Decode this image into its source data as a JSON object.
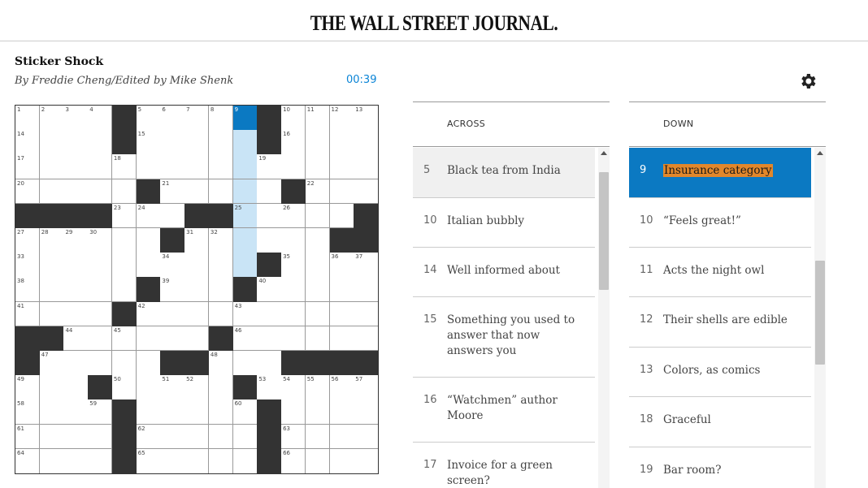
{
  "masthead": {
    "logo": "THE WALL STREET JOURNAL."
  },
  "puzzle": {
    "title": "Sticker Shock",
    "byline": "By Freddie Cheng/Edited by Mike Shenk",
    "timer": "00:39"
  },
  "icons": {
    "settings": "gear-icon",
    "scroll_up": "triangle-up-icon"
  },
  "colors": {
    "accent": "#0b79c2",
    "highlight": "#c9e4f6",
    "block": "#333333",
    "timer": "#0a84d6",
    "clue_highlight": "#e2872b"
  },
  "grid": {
    "size": 15,
    "rows": [
      "....#....1#....",
      "....#....0#....",
      "....#.........."
    ],
    "blocks": [
      [
        0,
        4
      ],
      [
        0,
        10
      ],
      [
        1,
        4
      ],
      [
        1,
        10
      ],
      [
        3,
        5
      ],
      [
        3,
        11
      ],
      [
        4,
        0
      ],
      [
        4,
        1
      ],
      [
        4,
        2
      ],
      [
        4,
        3
      ],
      [
        4,
        7
      ],
      [
        4,
        8
      ],
      [
        4,
        14
      ],
      [
        5,
        6
      ],
      [
        5,
        13
      ],
      [
        5,
        14
      ],
      [
        6,
        10
      ],
      [
        7,
        5
      ],
      [
        7,
        9
      ],
      [
        8,
        4
      ],
      [
        9,
        0
      ],
      [
        9,
        1
      ],
      [
        9,
        8
      ],
      [
        10,
        0
      ],
      [
        10,
        6
      ],
      [
        10,
        7
      ],
      [
        10,
        11
      ],
      [
        10,
        12
      ],
      [
        10,
        13
      ],
      [
        10,
        14
      ],
      [
        11,
        3
      ],
      [
        11,
        9
      ],
      [
        12,
        4
      ],
      [
        12,
        10
      ],
      [
        13,
        4
      ],
      [
        13,
        10
      ],
      [
        14,
        4
      ],
      [
        14,
        10
      ]
    ],
    "numbers": [
      [
        0,
        0,
        "1"
      ],
      [
        0,
        1,
        "2"
      ],
      [
        0,
        2,
        "3"
      ],
      [
        0,
        3,
        "4"
      ],
      [
        0,
        5,
        "5"
      ],
      [
        0,
        6,
        "6"
      ],
      [
        0,
        7,
        "7"
      ],
      [
        0,
        8,
        "8"
      ],
      [
        0,
        9,
        "9"
      ],
      [
        0,
        11,
        "10"
      ],
      [
        0,
        12,
        "11"
      ],
      [
        0,
        13,
        "12"
      ],
      [
        0,
        14,
        "13"
      ],
      [
        1,
        0,
        "14"
      ],
      [
        1,
        5,
        "15"
      ],
      [
        1,
        11,
        "16"
      ],
      [
        2,
        0,
        "17"
      ],
      [
        2,
        4,
        "18"
      ],
      [
        2,
        10,
        "19"
      ],
      [
        3,
        0,
        "20"
      ],
      [
        3,
        6,
        "21"
      ],
      [
        3,
        12,
        "22"
      ],
      [
        4,
        4,
        "23"
      ],
      [
        4,
        5,
        "24"
      ],
      [
        4,
        9,
        "25"
      ],
      [
        4,
        11,
        "26"
      ],
      [
        5,
        0,
        "27"
      ],
      [
        5,
        1,
        "28"
      ],
      [
        5,
        2,
        "29"
      ],
      [
        5,
        3,
        "30"
      ],
      [
        5,
        7,
        "31"
      ],
      [
        5,
        8,
        "32"
      ],
      [
        6,
        0,
        "33"
      ],
      [
        6,
        6,
        "34"
      ],
      [
        6,
        11,
        "35"
      ],
      [
        6,
        13,
        "36"
      ],
      [
        6,
        14,
        "37"
      ],
      [
        7,
        0,
        "38"
      ],
      [
        7,
        6,
        "39"
      ],
      [
        7,
        10,
        "40"
      ],
      [
        8,
        0,
        "41"
      ],
      [
        8,
        5,
        "42"
      ],
      [
        8,
        9,
        "43"
      ],
      [
        9,
        2,
        "44"
      ],
      [
        9,
        4,
        "45"
      ],
      [
        9,
        9,
        "46"
      ],
      [
        10,
        1,
        "47"
      ],
      [
        10,
        8,
        "48"
      ],
      [
        11,
        0,
        "49"
      ],
      [
        11,
        4,
        "50"
      ],
      [
        11,
        6,
        "51"
      ],
      [
        11,
        7,
        "52"
      ],
      [
        11,
        10,
        "53"
      ],
      [
        11,
        11,
        "54"
      ],
      [
        11,
        12,
        "55"
      ],
      [
        11,
        13,
        "56"
      ],
      [
        11,
        14,
        "57"
      ],
      [
        12,
        0,
        "58"
      ],
      [
        12,
        3,
        "59"
      ],
      [
        12,
        9,
        "60"
      ],
      [
        13,
        0,
        "61"
      ],
      [
        13,
        5,
        "62"
      ],
      [
        13,
        11,
        "63"
      ],
      [
        14,
        0,
        "64"
      ],
      [
        14,
        5,
        "65"
      ],
      [
        14,
        11,
        "66"
      ]
    ],
    "active": [
      0,
      9
    ],
    "highlighted": [
      [
        1,
        9
      ],
      [
        2,
        9
      ],
      [
        3,
        9
      ],
      [
        4,
        9
      ],
      [
        5,
        9
      ],
      [
        6,
        9
      ]
    ]
  },
  "across": {
    "heading": "ACROSS",
    "clues": [
      {
        "num": "5",
        "text": "Black tea from India"
      },
      {
        "num": "10",
        "text": "Italian bubbly"
      },
      {
        "num": "14",
        "text": "Well informed about"
      },
      {
        "num": "15",
        "text": "Something you used to answer that now answers you"
      },
      {
        "num": "16",
        "text": "“Watchmen” author Moore"
      },
      {
        "num": "17",
        "text": "Invoice for a green screen?"
      }
    ]
  },
  "down": {
    "heading": "DOWN",
    "clues": [
      {
        "num": "9",
        "text": "Insurance category"
      },
      {
        "num": "10",
        "text": "“Feels great!”"
      },
      {
        "num": "11",
        "text": "Acts the night owl"
      },
      {
        "num": "12",
        "text": "Their shells are edible"
      },
      {
        "num": "13",
        "text": "Colors, as comics"
      },
      {
        "num": "18",
        "text": "Graceful"
      },
      {
        "num": "19",
        "text": "Bar room?"
      }
    ]
  },
  "scroll": {
    "across_position": 0.0,
    "down_position": 0.45
  }
}
